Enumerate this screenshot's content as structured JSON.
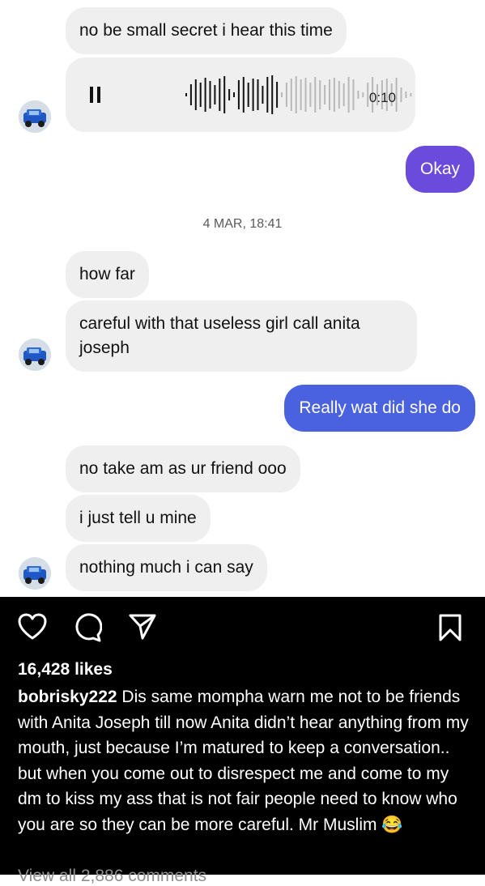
{
  "messages": [
    {
      "text": "no be small secret i hear this time"
    },
    {
      "duration": "0:10"
    },
    {
      "text": "Okay"
    },
    {
      "text": "how far"
    },
    {
      "text": "careful with that useless girl call anita joseph"
    },
    {
      "text": "Really wat did she do"
    },
    {
      "text": "no take am as ur friend ooo"
    },
    {
      "text": "i just tell u mine"
    },
    {
      "text": "nothing much i can say"
    }
  ],
  "timestamp": "4 MAR, 18:41",
  "post": {
    "likes": "16,428 likes",
    "username": "bobrisky222",
    "caption": "Dis same mompha warn me not to be friends with Anita Joseph till now Anita didn’t hear anything from my mouth, just because I’m matured to keep a conversation.. but when you come out to disrespect me and come to my dm to kiss my ass that is not fair people need to know who you are so they can be more careful. Mr Muslim 😂",
    "view_all": "View all 2,886 comments"
  },
  "colors": {
    "outgoing_bubble": "#6a4bdc",
    "incoming_bubble": "#efefef",
    "post_bg": "#000000"
  },
  "icons": [
    "avatar",
    "pause-icon",
    "waveform",
    "heart-icon",
    "comment-icon",
    "share-icon",
    "bookmark-icon"
  ]
}
